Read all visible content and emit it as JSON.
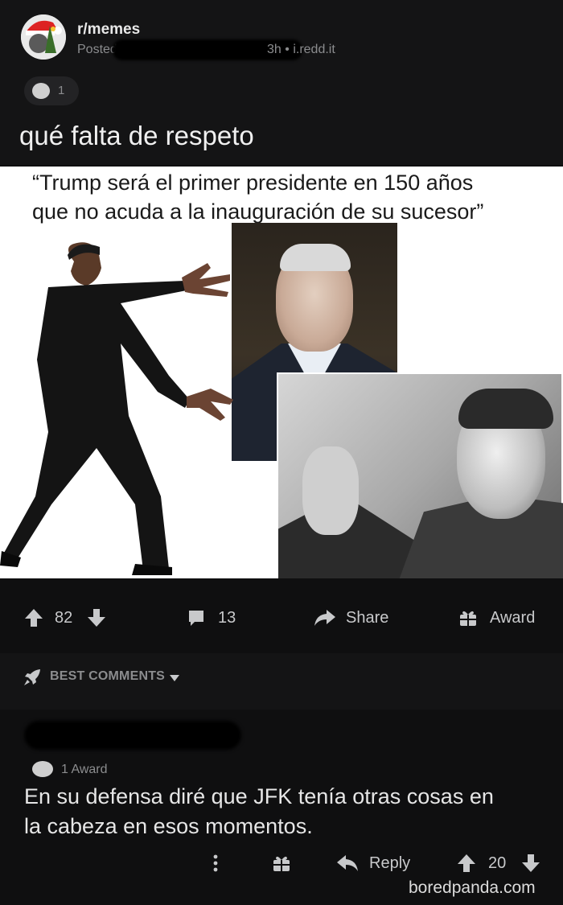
{
  "post": {
    "subreddit": "r/memes",
    "posted_prefix": "Posted b",
    "age": "3h",
    "separator": "•",
    "domain": "i.redd.it",
    "award_count": "1",
    "title": "qué falta de respeto"
  },
  "meme": {
    "caption_line1": "“Trump será el primer presidente en 150 años",
    "caption_line2": "que no acuda a la inauguración de su sucesor”"
  },
  "actions": {
    "upvotes": "82",
    "comments": "13",
    "share_label": "Share",
    "award_label": "Award"
  },
  "comments_section": {
    "sort_label": "BEST COMMENTS"
  },
  "comment": {
    "award_label": "1 Award",
    "body_line1": "En su defensa diré que JFK tenía otras cosas en",
    "body_line2": "la cabeza en esos momentos.",
    "reply_label": "Reply",
    "score": "20"
  },
  "watermark": "boredpanda.com",
  "icons": [
    "upvote-icon",
    "downvote-icon",
    "comment-icon",
    "share-icon",
    "award-icon",
    "rocket-icon",
    "chevron-down-icon",
    "more-icon",
    "gift-icon",
    "reply-icon"
  ]
}
